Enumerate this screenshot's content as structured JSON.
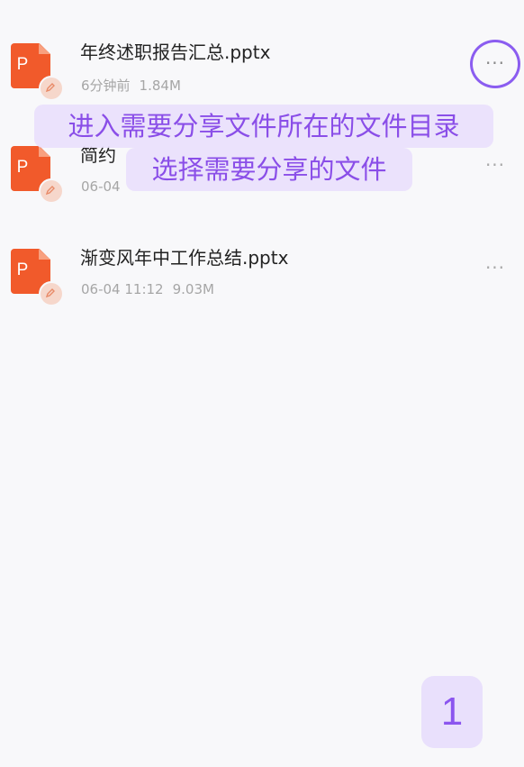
{
  "files": [
    {
      "name": "年终述职报告汇总.pptx",
      "time": "6分钟前",
      "size": "1.84M",
      "icon": "ppt-file-icon",
      "letter": "P"
    },
    {
      "name": "简约",
      "time": "06-04",
      "size": "",
      "icon": "ppt-file-icon",
      "letter": "P"
    },
    {
      "name": "渐变风年中工作总结.pptx",
      "time": "06-04 11:12",
      "size": "9.03M",
      "icon": "ppt-file-icon",
      "letter": "P"
    }
  ],
  "more_label": "···",
  "hint": {
    "line1": "进入需要分享文件所在的文件目录",
    "line2": "选择需要分享的文件"
  },
  "step_number": "1",
  "colors": {
    "accent": "#8b5df0",
    "ppt_orange": "#f15a2b",
    "hint_bg": "#e9e0fc",
    "hint_text": "#8a4ee8"
  }
}
